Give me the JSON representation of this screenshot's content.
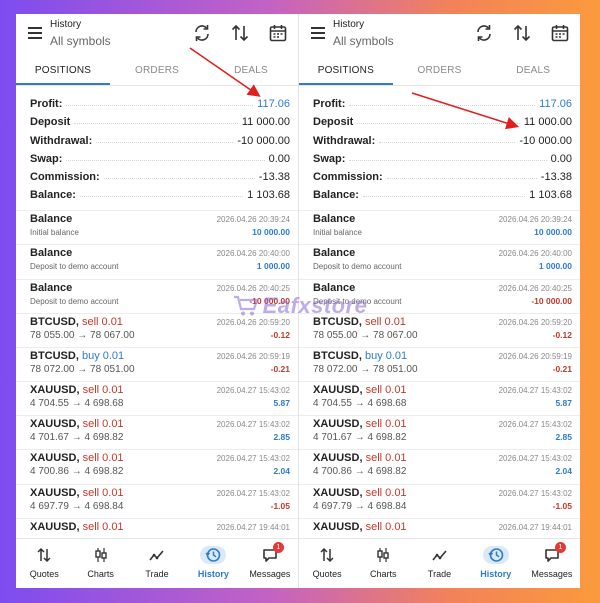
{
  "header": {
    "title": "History",
    "subtitle": "All symbols"
  },
  "header_icons": [
    "refresh-icon",
    "sort-icon",
    "calendar-icon"
  ],
  "tabs": [
    {
      "label": "POSITIONS",
      "active": true
    },
    {
      "label": "ORDERS",
      "active": false
    },
    {
      "label": "DEALS",
      "active": false
    }
  ],
  "summary": {
    "profit": {
      "label": "Profit:",
      "value": "117.06"
    },
    "deposit": {
      "label": "Deposit",
      "value": "11 000.00"
    },
    "withdrawal": {
      "label": "Withdrawal:",
      "value": "-10 000.00"
    },
    "swap": {
      "label": "Swap:",
      "value": "0.00"
    },
    "commission": {
      "label": "Commission:",
      "value": "-13.38"
    },
    "balance": {
      "label": "Balance:",
      "value": "1 103.68"
    }
  },
  "deals": [
    {
      "name": "Balance",
      "side": "",
      "time": "2026.04.26 20:39:24",
      "sub": "Initial balance",
      "amount": "10 000.00",
      "amount_color": "blue"
    },
    {
      "name": "Balance",
      "side": "",
      "time": "2026.04.26 20:40:00",
      "sub": "Deposit to demo account",
      "amount": "1 000.00",
      "amount_color": "blue"
    },
    {
      "name": "Balance",
      "side": "",
      "time": "2026.04.26 20:40:25",
      "sub": "Deposit to demo account",
      "amount": "-10 000.00",
      "amount_color": "red"
    },
    {
      "name": "BTCUSD,",
      "side": "sell 0.01",
      "side_type": "sell",
      "time": "2026.04.26 20:59:20",
      "prices": "78 055.00 → 78 067.00",
      "amount": "-0.12",
      "amount_color": "red"
    },
    {
      "name": "BTCUSD,",
      "side": "buy 0.01",
      "side_type": "buy",
      "time": "2026.04.26 20:59:19",
      "prices": "78 072.00 → 78 051.00",
      "amount": "-0.21",
      "amount_color": "red"
    },
    {
      "name": "XAUUSD,",
      "side": "sell 0.01",
      "side_type": "sell",
      "time": "2026.04.27 15:43:02",
      "prices": "4 704.55 → 4 698.68",
      "amount": "5.87",
      "amount_color": "blue"
    },
    {
      "name": "XAUUSD,",
      "side": "sell 0.01",
      "side_type": "sell",
      "time": "2026.04.27 15:43:02",
      "prices": "4 701.67 → 4 698.82",
      "amount": "2.85",
      "amount_color": "blue"
    },
    {
      "name": "XAUUSD,",
      "side": "sell 0.01",
      "side_type": "sell",
      "time": "2026.04.27 15:43:02",
      "prices": "4 700.86 → 4 698.82",
      "amount": "2.04",
      "amount_color": "blue"
    },
    {
      "name": "XAUUSD,",
      "side": "sell 0.01",
      "side_type": "sell",
      "time": "2026.04.27 15:43:02",
      "prices": "4 697.79 → 4 698.84",
      "amount": "-1.05",
      "amount_color": "red"
    },
    {
      "name": "XAUUSD,",
      "side": "sell 0.01",
      "side_type": "sell",
      "time": "2026.04.27 19:44:01",
      "prices": "",
      "amount": "",
      "amount_color": "red"
    }
  ],
  "nav": [
    {
      "label": "Quotes",
      "icon": "quotes-icon",
      "active": false
    },
    {
      "label": "Charts",
      "icon": "charts-icon",
      "active": false
    },
    {
      "label": "Trade",
      "icon": "trade-icon",
      "active": false
    },
    {
      "label": "History",
      "icon": "history-icon",
      "active": true
    },
    {
      "label": "Messages",
      "icon": "messages-icon",
      "active": false,
      "badge": "1"
    }
  ],
  "watermark": {
    "text": "Eafxstore"
  },
  "colors": {
    "accent": "#2d7cc7",
    "negative": "#c0392b",
    "arrow": "#e02020"
  }
}
